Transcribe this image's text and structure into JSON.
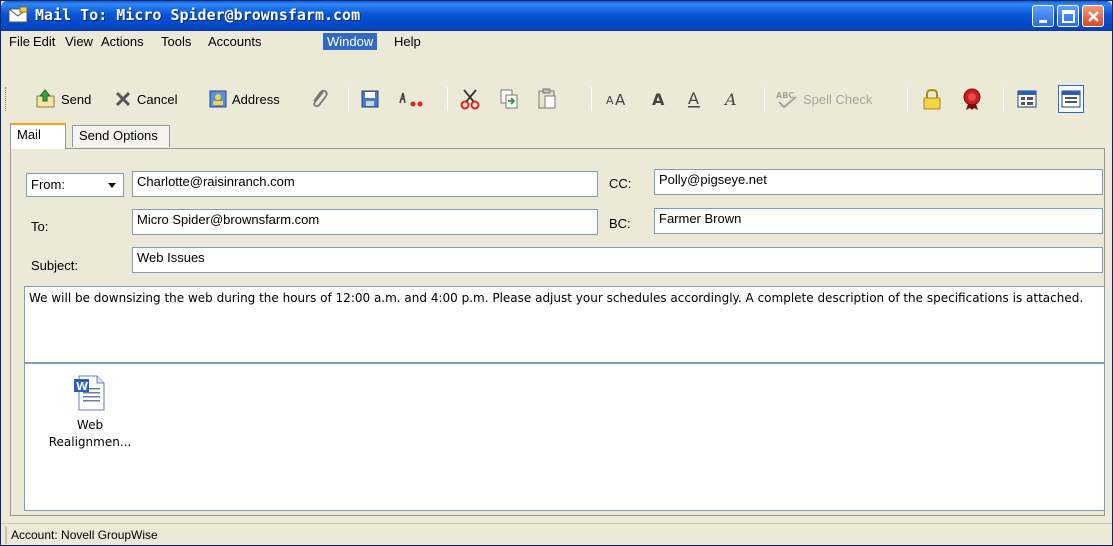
{
  "window": {
    "title": "Mail To: Micro Spider@brownsfarm.com"
  },
  "menu": [
    "File",
    "Edit",
    "View",
    "Actions",
    "Tools",
    "Accounts",
    "Window",
    "Help"
  ],
  "menu_active": "Window",
  "toolbar": {
    "send": "Send",
    "cancel": "Cancel",
    "address": "Address",
    "spell_check": "Spell Check"
  },
  "tabs": [
    "Mail",
    "Send Options"
  ],
  "form": {
    "from_label": "From:",
    "from_value": "Charlotte@raisinranch.com",
    "to_label": "To:",
    "to_value": "Micro Spider@brownsfarm.com",
    "cc_label": "CC:",
    "cc_value": "Polly@pigseye.net",
    "bc_label": "BC:",
    "bc_value": "Farmer Brown",
    "subject_label": "Subject:",
    "subject_value": "Web Issues",
    "body": "We will be downsizing the web during the hours of 12:00 a.m. and 4:00 p.m.  Please adjust your schedules accordingly.  A complete description of the specifications is attached."
  },
  "attachment": {
    "line1": "Web",
    "line2": "Realignmen..."
  },
  "status": {
    "account": "Account: Novell GroupWise"
  }
}
